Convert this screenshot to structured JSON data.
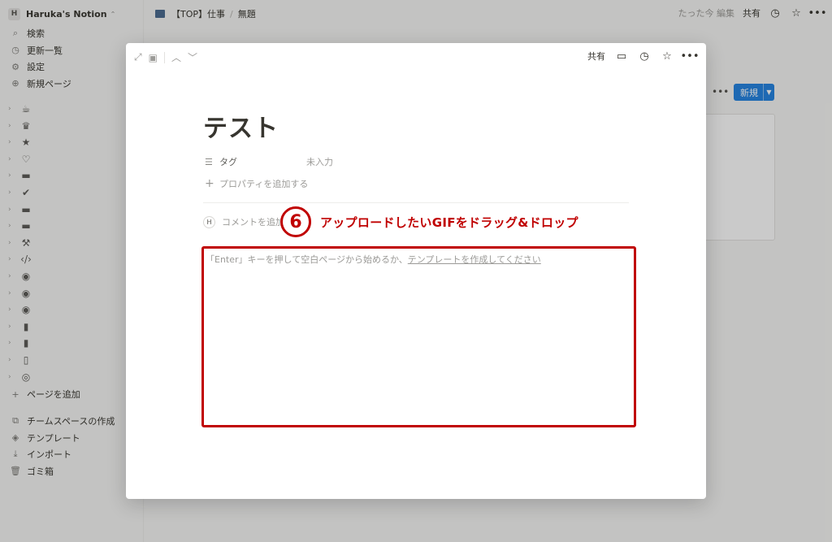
{
  "sidebar": {
    "workspace": {
      "name": "Haruka's Notion",
      "initial": "H"
    },
    "nav": [
      {
        "label": "検索",
        "icon": "search-icon",
        "glyph": "⌕"
      },
      {
        "label": "更新一覧",
        "icon": "clock-icon",
        "glyph": "◷"
      },
      {
        "label": "設定",
        "icon": "gear-icon",
        "glyph": "⚙"
      },
      {
        "label": "新規ページ",
        "icon": "plus-circle-icon",
        "glyph": "⊕"
      }
    ],
    "tree": [
      {
        "icon": "coffee-icon",
        "glyph": "☕"
      },
      {
        "icon": "chess-icon",
        "glyph": "♛"
      },
      {
        "icon": "star-icon",
        "glyph": "★"
      },
      {
        "icon": "heart-icon",
        "glyph": "♡"
      },
      {
        "icon": "monitor-icon",
        "glyph": "▬"
      },
      {
        "icon": "check-circle-icon",
        "glyph": "✔"
      },
      {
        "icon": "monitor-icon",
        "glyph": "▬"
      },
      {
        "icon": "monitor-icon",
        "glyph": "▬"
      },
      {
        "icon": "hammer-icon",
        "glyph": "⚒"
      },
      {
        "icon": "code-icon",
        "glyph": "‹/›"
      },
      {
        "icon": "palette-icon",
        "glyph": "◉"
      },
      {
        "icon": "palette-icon",
        "glyph": "◉"
      },
      {
        "icon": "palette-icon",
        "glyph": "◉"
      },
      {
        "icon": "book-icon",
        "glyph": "▮"
      },
      {
        "icon": "bookmark-icon",
        "glyph": "▮"
      },
      {
        "icon": "open-book-icon",
        "glyph": "▯"
      },
      {
        "icon": "target-icon",
        "glyph": "◎"
      }
    ],
    "add_page": {
      "label": "ページを追加",
      "glyph": "+"
    },
    "bottom": [
      {
        "label": "チームスペースの作成",
        "icon": "teamspace-icon",
        "glyph": "⧉"
      },
      {
        "label": "テンプレート",
        "icon": "template-icon",
        "glyph": "◈"
      },
      {
        "label": "インポート",
        "icon": "import-icon",
        "glyph": "⤓"
      },
      {
        "label": "ゴミ箱",
        "icon": "trash-icon",
        "glyph": "🗑"
      }
    ]
  },
  "topbar": {
    "breadcrumb": [
      "【TOP】仕事",
      "無題"
    ],
    "edited": "たった今 編集",
    "share": "共有"
  },
  "background": {
    "new_button": "新規",
    "more": "•••"
  },
  "modal": {
    "share": "共有",
    "title": "テスト",
    "property": {
      "name": "タグ",
      "value": "未入力"
    },
    "add_property": "プロパティを追加する",
    "comment_avatar": "H",
    "comment_placeholder": "コメントを追加...",
    "placeholder_prefix": "「Enter」キーを押して空白ページから始めるか、",
    "placeholder_link": "テンプレートを作成してください"
  },
  "annotation": {
    "number": "6",
    "text": "アップロードしたいGIFをドラッグ&ドロップ",
    "color": "#c00000"
  }
}
